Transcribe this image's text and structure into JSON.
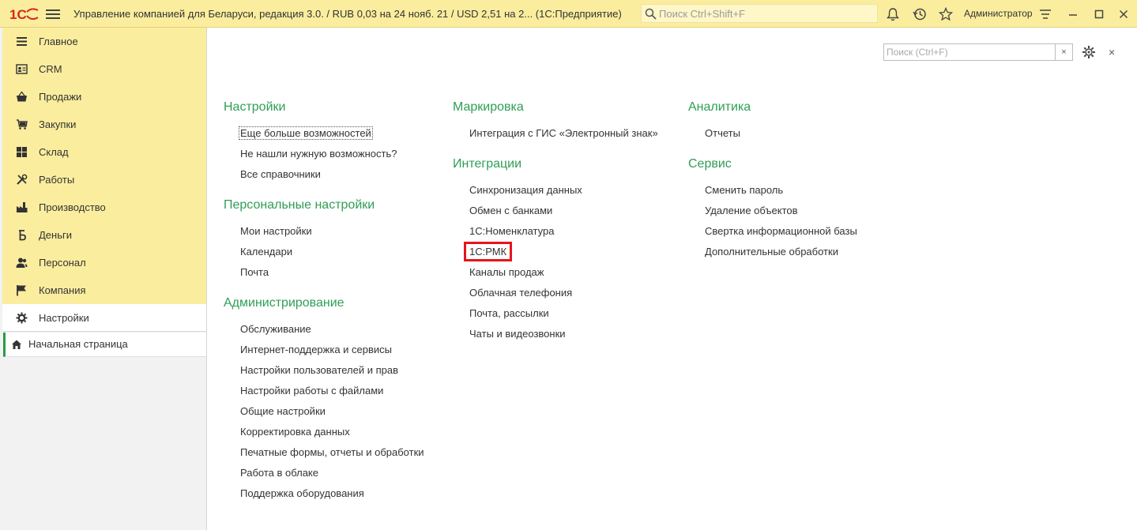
{
  "window": {
    "title": "Управление компанией для Беларуси, редакция 3.0.  / RUB 0,03 на 24 нояб. 21 / USD 2,51 на 2...  (1С:Предприятие)",
    "global_search_placeholder": "Поиск Ctrl+Shift+F",
    "user": "Администратор",
    "icons": [
      "logo-1c",
      "hamburger-icon",
      "search-icon",
      "bell-icon",
      "history-icon",
      "star-icon",
      "settings-menu-icon",
      "minimize-icon",
      "maximize-icon",
      "close-icon"
    ]
  },
  "sidebar": {
    "items": [
      {
        "label": "Главное",
        "icon": "menu-lines-icon"
      },
      {
        "label": "CRM",
        "icon": "contact-card-icon"
      },
      {
        "label": "Продажи",
        "icon": "basket-icon"
      },
      {
        "label": "Закупки",
        "icon": "cart-icon"
      },
      {
        "label": "Склад",
        "icon": "warehouse-grid-icon"
      },
      {
        "label": "Работы",
        "icon": "tools-icon"
      },
      {
        "label": "Производство",
        "icon": "factory-icon"
      },
      {
        "label": "Деньги",
        "icon": "ruble-icon"
      },
      {
        "label": "Персонал",
        "icon": "people-icon"
      },
      {
        "label": "Компания",
        "icon": "flag-icon"
      },
      {
        "label": "Настройки",
        "icon": "gear-icon",
        "active": true
      }
    ],
    "home_page": {
      "label": "Начальная страница",
      "icon": "home-icon"
    }
  },
  "content": {
    "filter_placeholder": "Поиск (Ctrl+F)",
    "clear_label": "×",
    "close_label": "×",
    "columns": [
      {
        "sections": [
          {
            "title": "Настройки",
            "links": [
              "Еще больше возможностей",
              "Не нашли нужную возможность?",
              "Все справочники"
            ]
          },
          {
            "title": "Персональные настройки",
            "links": [
              "Мои настройки",
              "Календари",
              "Почта"
            ]
          },
          {
            "title": "Администрирование",
            "links": [
              "Обслуживание",
              "Интернет-поддержка и сервисы",
              "Настройки пользователей и прав",
              "Настройки работы с файлами",
              "Общие настройки",
              "Корректировка данных",
              "Печатные формы, отчеты и обработки",
              "Работа в облаке",
              "Поддержка оборудования"
            ]
          }
        ]
      },
      {
        "sections": [
          {
            "title": "Маркировка",
            "links": [
              "Интеграция с ГИС «Электронный знак»"
            ]
          },
          {
            "title": "Интеграции",
            "links": [
              "Синхронизация данных",
              "Обмен с банками",
              "1С:Номенклатура",
              "1С:РМК",
              "Каналы продаж",
              "Облачная телефония",
              "Почта, рассылки",
              "Чаты и видеозвонки"
            ]
          }
        ]
      },
      {
        "sections": [
          {
            "title": "Аналитика",
            "links": [
              "Отчеты"
            ]
          },
          {
            "title": "Сервис",
            "links": [
              "Сменить пароль",
              "Удаление объектов",
              "Свертка информационной базы",
              "Дополнительные обработки"
            ]
          }
        ]
      }
    ],
    "focused_link": "Еще больше возможностей",
    "highlighted_link": "1С:РМК",
    "colors": {
      "section_title": "#2f9e56",
      "panel": "#fbed9e",
      "highlight": "#e8141b",
      "home_marker": "#2a9a45"
    }
  }
}
